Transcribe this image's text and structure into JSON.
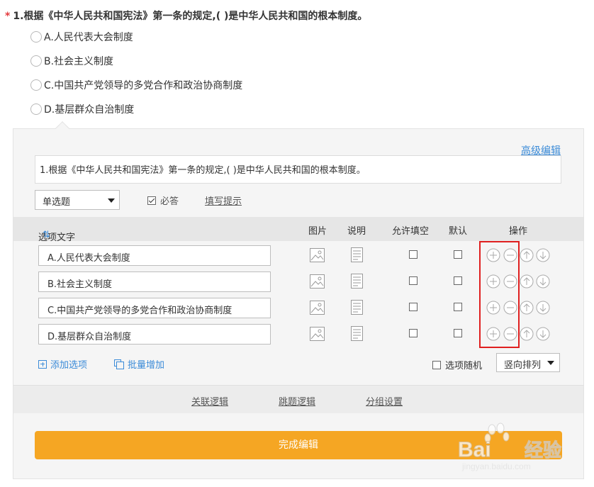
{
  "question": {
    "required_mark": "*",
    "title": "1.根据《中华人民共和国宪法》第一条的规定,( )是中华人民共和国的根本制度。",
    "options": [
      "A.人民代表大会制度",
      "B.社会主义制度",
      "C.中国共产党领导的多党合作和政治协商制度",
      "D.基层群众自治制度"
    ]
  },
  "editor": {
    "advanced_edit": "高级编辑",
    "title_value": "1.根据《中华人民共和国宪法》第一条的规定,(   )是中华人民共和国的根本制度。",
    "type_select": "单选题",
    "required_label": "必答",
    "required_checked": true,
    "hint_link": "填写提示",
    "columns": {
      "text": "选项文字",
      "sort": "⇅",
      "image": "图片",
      "desc": "说明",
      "fill": "允许填空",
      "default": "默认",
      "ops": "操作"
    },
    "rows": [
      {
        "text": "A.人民代表大会制度"
      },
      {
        "text": "B.社会主义制度"
      },
      {
        "text": "C.中国共产党领导的多党合作和政治协商制度"
      },
      {
        "text": "D.基层群众自治制度"
      }
    ],
    "add_option": "添加选项",
    "batch_add": "批量增加",
    "random_label": "选项随机",
    "order_select": "竖向排列",
    "logic": {
      "related": "关联逻辑",
      "jump": "跳题逻辑",
      "group": "分组设置"
    },
    "done_button": "完成编辑"
  },
  "watermark": {
    "brand": "Baidu经验",
    "url": "jingyan.baidu.com"
  },
  "colors": {
    "accent": "#f5a623",
    "link": "#3b8bd8",
    "highlight": "#e02020"
  }
}
